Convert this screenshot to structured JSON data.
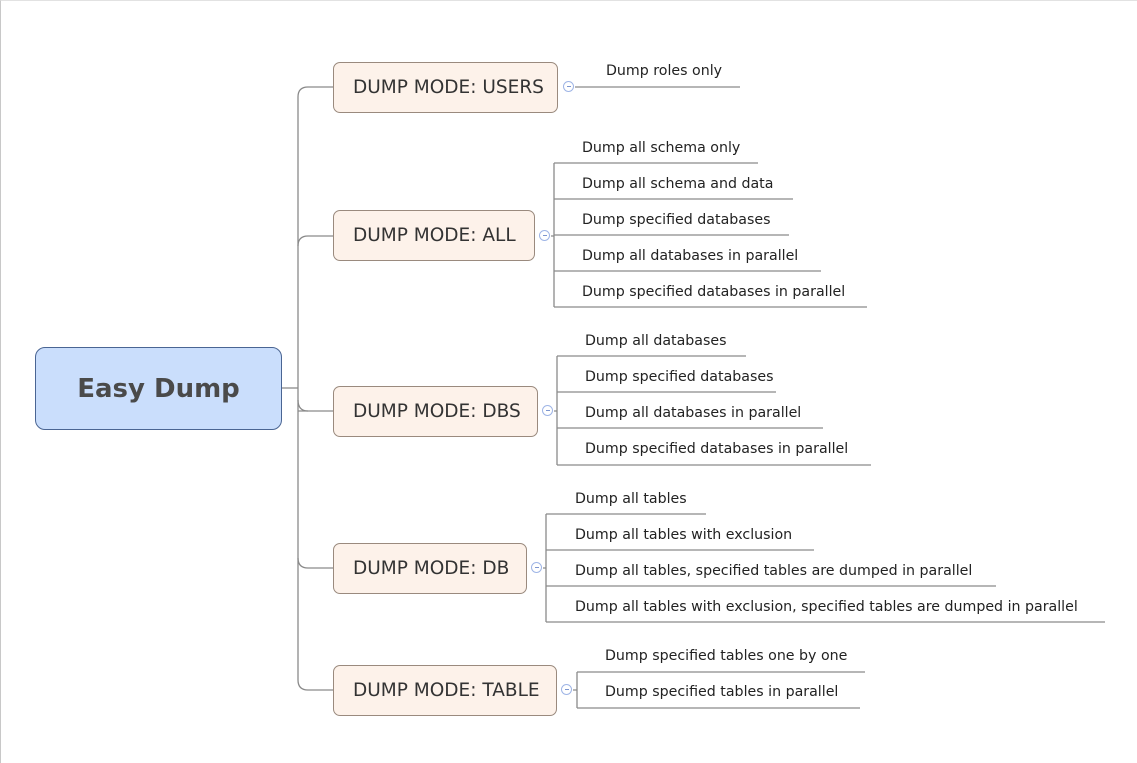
{
  "root": {
    "label": "Easy Dump"
  },
  "colors": {
    "root_fill": "#cadefc",
    "root_border": "#4a6593",
    "mode_fill": "#fdf2ea",
    "mode_border": "#9a8a7e",
    "line": "#8a8a8a",
    "collapse": "#9fb5e6"
  },
  "modes": [
    {
      "label": "DUMP MODE: USERS",
      "children": [
        "Dump roles only"
      ]
    },
    {
      "label": "DUMP MODE: ALL",
      "children": [
        "Dump all schema only",
        "Dump all schema and data",
        "Dump specified databases",
        "Dump all databases in parallel",
        "Dump specified databases in parallel"
      ]
    },
    {
      "label": "DUMP MODE: DBS",
      "children": [
        "Dump all databases",
        "Dump specified databases",
        "Dump all databases in parallel",
        "Dump specified databases in parallel"
      ]
    },
    {
      "label": "DUMP MODE: DB",
      "children": [
        "Dump all tables",
        "Dump all tables with exclusion",
        "Dump all tables, specified tables are dumped in parallel",
        "Dump all tables with exclusion, specified tables are dumped in parallel"
      ]
    },
    {
      "label": "DUMP MODE: TABLE",
      "children": [
        "Dump specified tables one by one",
        "Dump specified tables in parallel"
      ]
    }
  ]
}
